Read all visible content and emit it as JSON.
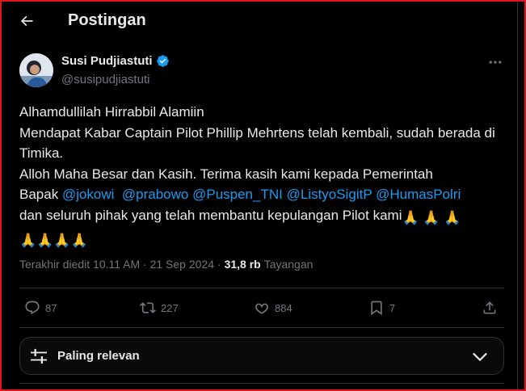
{
  "header": {
    "title": "Postingan"
  },
  "author": {
    "name": "Susi Pudjiastuti",
    "handle": "@susipudjiastuti"
  },
  "post": {
    "line1": "Alhamdullilah Hirrabbil Alamiin",
    "line2": "Mendapat Kabar Captain Pilot Phillip Mehrtens telah kembali, sudah berada di Timika.",
    "line3": "Alloh Maha Besar dan Kasih. Terima kasih kami kepada Pemerintah",
    "line4_prefix": "Bapak ",
    "mentions": [
      "@jokowi",
      "@prabowo",
      "@Puspen_TNI",
      "@ListyoSigitP",
      "@HumasPolri"
    ],
    "line5": "dan seluruh pihak yang telah membantu kepulangan Pilot kami",
    "emoji": "🙏"
  },
  "meta": {
    "edited": "Terakhir diedit 10.11 AM · 21 Sep 2024 · ",
    "views_count": "31,8 rb",
    "views_label": "Tayangan"
  },
  "actions": {
    "replies": "87",
    "reposts": "227",
    "likes": "884",
    "bookmarks": "7"
  },
  "sort": {
    "label": "Paling relevan"
  },
  "colors": {
    "accent": "#1d9bf0",
    "text": "#e7e9ea",
    "muted": "#71767b",
    "border": "#2f3336"
  }
}
